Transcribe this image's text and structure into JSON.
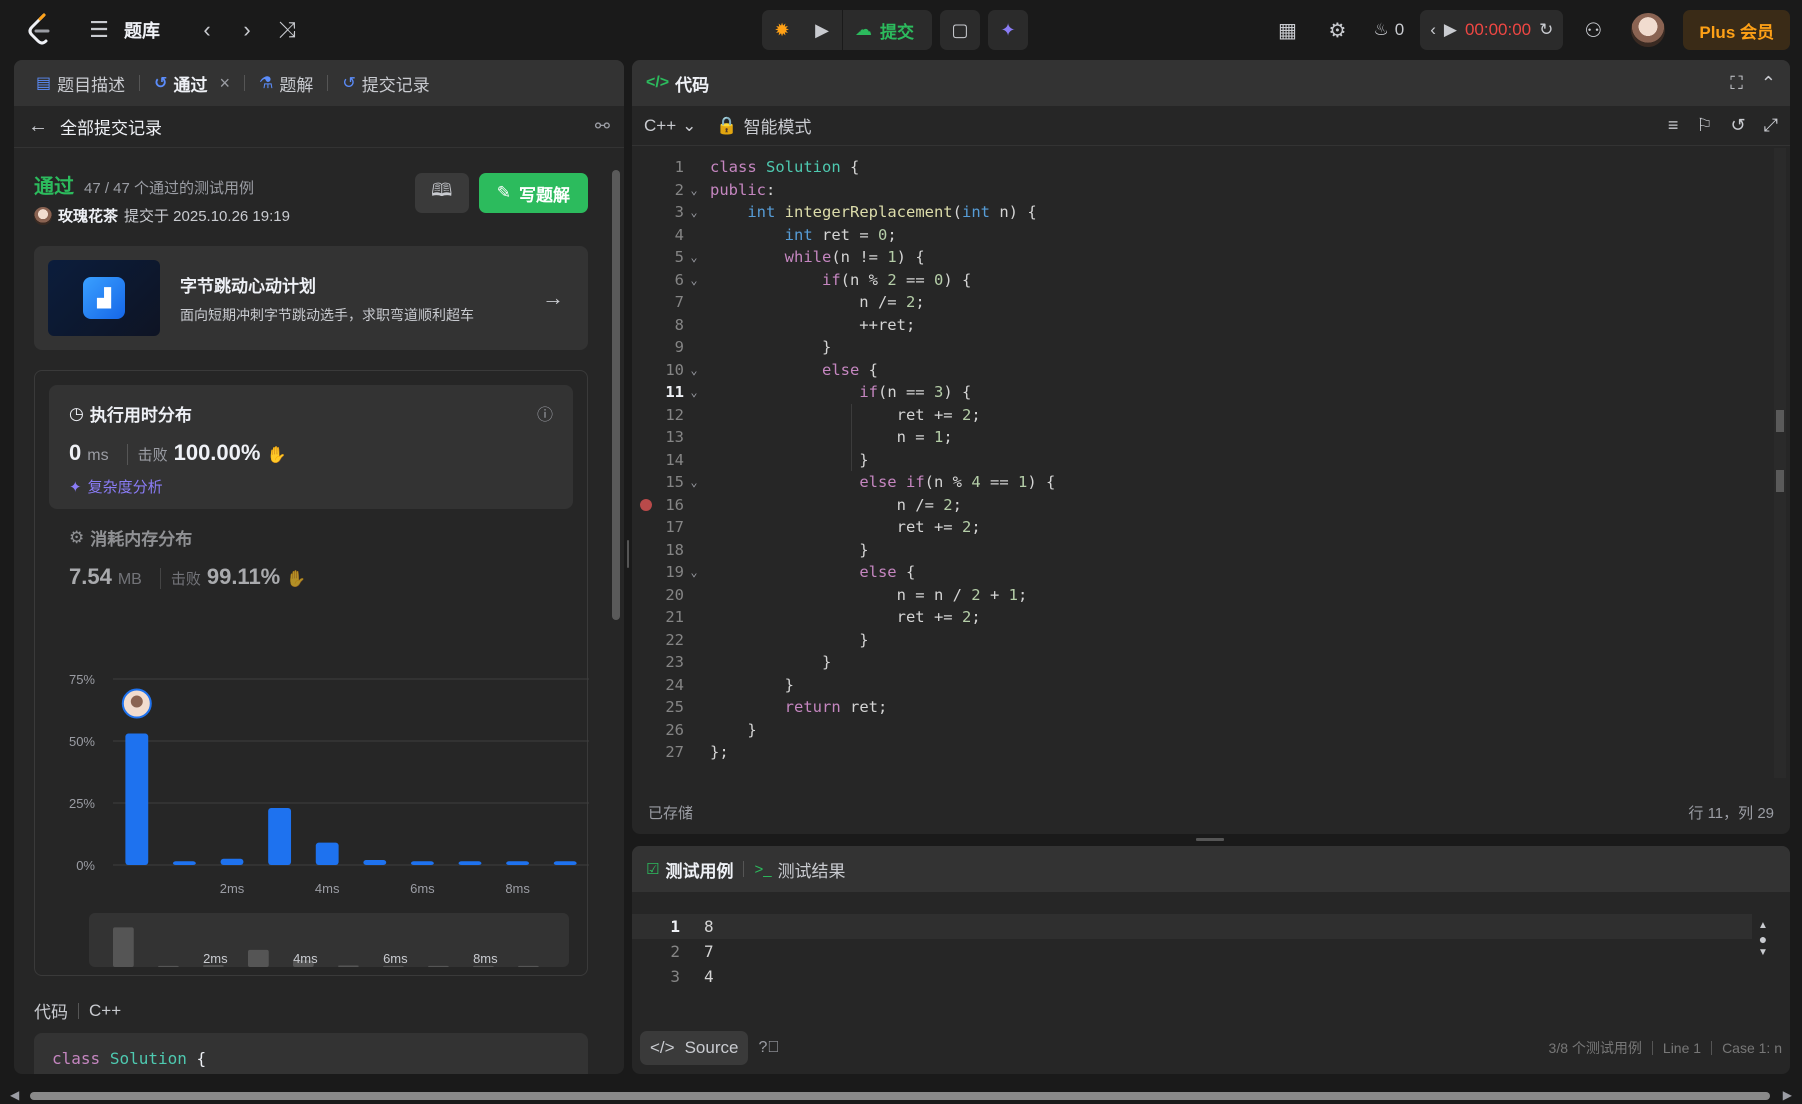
{
  "topbar": {
    "problem_list_label": "题库",
    "submit_label": "提交",
    "streak_count": "0",
    "timer": "00:00:00",
    "plus_label": "Plus 会员"
  },
  "left": {
    "tabs": [
      {
        "label": "题目描述"
      },
      {
        "label": "通过"
      },
      {
        "label": "题解"
      },
      {
        "label": "提交记录"
      }
    ],
    "back_label": "全部提交记录",
    "status": {
      "result": "通过",
      "cases": "47 / 47 个通过的测试用例",
      "user": "玫瑰花茶",
      "submitted_at": "提交于 2025.10.26 19:19",
      "write_solution": "写题解"
    },
    "promo": {
      "title": "字节跳动心动计划",
      "subtitle": "面向短期冲刺字节跳动选手，求职弯道顺利超车"
    },
    "runtime": {
      "title": "执行用时分布",
      "value": "0",
      "unit": "ms",
      "beat_label": "击败",
      "beat_value": "100.00%",
      "complexity_link": "复杂度分析"
    },
    "memory": {
      "title": "消耗内存分布",
      "value": "7.54",
      "unit": "MB",
      "beat_label": "击败",
      "beat_value": "99.11%"
    },
    "code_label": "代码",
    "code_lang": "C++",
    "code_preview": [
      "class Solution {",
      "public:"
    ]
  },
  "chart_data": {
    "type": "bar",
    "categories": [
      "0ms",
      "1ms",
      "2ms",
      "3ms",
      "4ms",
      "5ms",
      "6ms",
      "7ms",
      "8ms",
      "9ms"
    ],
    "x_tick_labels": [
      "2ms",
      "4ms",
      "6ms",
      "8ms"
    ],
    "values": [
      53,
      1.5,
      2.5,
      23,
      9,
      2,
      1.5,
      1.5,
      1.5,
      1.5
    ],
    "ylim": [
      0,
      75
    ],
    "y_tick_labels": [
      "75%",
      "50%",
      "25%",
      "0%"
    ],
    "grid": true,
    "highlight_category": "0ms",
    "colors": {
      "bar": "#1e72ef",
      "mini_bar": "#555555"
    }
  },
  "editor": {
    "title": "代码",
    "language": "C++",
    "mode": "智能模式",
    "saved_label": "已存储",
    "cursor_pos": "行 11，列 29",
    "lines": [
      "class Solution {",
      "public:",
      "    int integerReplacement(int n) {",
      "        int ret = 0;",
      "        while(n != 1) {",
      "            if(n % 2 == 0) {",
      "                n /= 2;",
      "                ++ret;",
      "            }",
      "            else {",
      "                if(n == 3) {",
      "                    ret += 2;",
      "                    n = 1;",
      "                }",
      "                else if(n % 4 == 1) {",
      "                    n /= 2;",
      "                    ret += 2;",
      "                }",
      "                else {",
      "                    n = n / 2 + 1;",
      "                    ret += 2;",
      "                }",
      "            }",
      "        }",
      "        return ret;",
      "    }",
      "};"
    ]
  },
  "test": {
    "tab_cases": "测试用例",
    "tab_results": "测试结果",
    "lines": [
      "8",
      "7",
      "4"
    ],
    "source_label": "Source",
    "status_cases": "3/8 个测试用例",
    "status_line": "Line 1",
    "status_case": "Case 1: n"
  }
}
